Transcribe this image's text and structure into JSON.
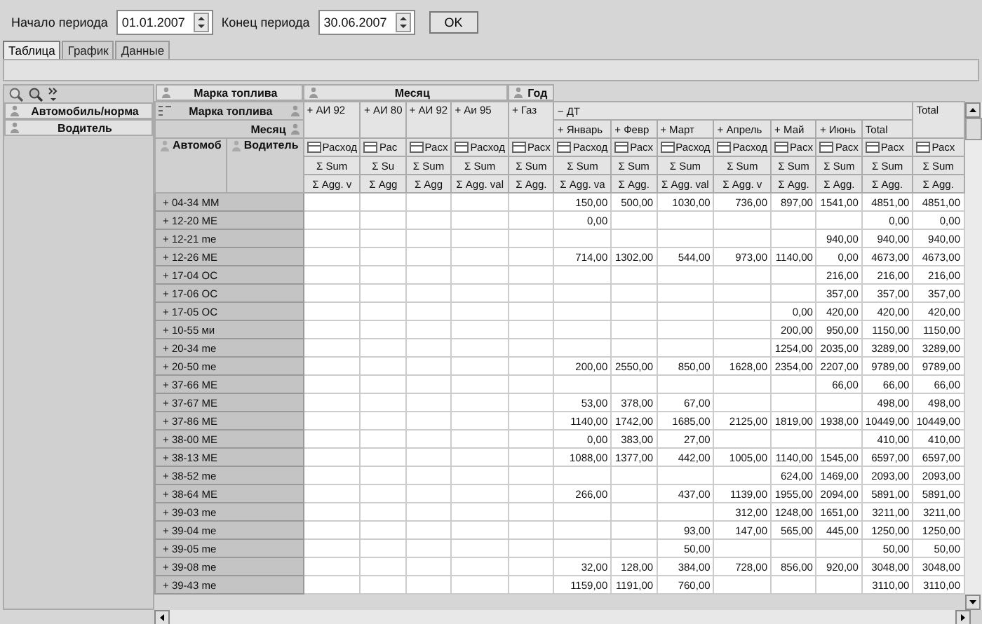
{
  "toolbar": {
    "start_label": "Начало периода",
    "start_value": "01.01.2007",
    "end_label": "Конец периода",
    "end_value": "30.06.2007",
    "ok_button": "OK"
  },
  "tabs": [
    {
      "label": "Таблица",
      "selected": true
    },
    {
      "label": "График",
      "selected": false
    },
    {
      "label": "Данные",
      "selected": false
    }
  ],
  "pivot": {
    "row_fields": [
      "Автомобиль/норма",
      "Водитель"
    ],
    "column_fields": [
      "Марка топлива",
      "Месяц",
      "Год"
    ],
    "column_area_labels": [
      "Марка топлива",
      "Месяц"
    ],
    "row_headers": [
      "Автомоб",
      "Водитель"
    ],
    "fuel_headers": [
      {
        "label": "+ АИ 92"
      },
      {
        "label": "+ АИ 80"
      },
      {
        "label": "+ АИ 92"
      },
      {
        "label": "+ Аи 95"
      },
      {
        "label": "+ Газ"
      },
      {
        "label": "− ДТ",
        "children": [
          "+ Январь",
          "+ Февр",
          "+ Март",
          "+ Апрель",
          "+ Май",
          "+ Июнь",
          "Total"
        ]
      },
      {
        "label": "Total"
      }
    ],
    "data_fields": [
      "Расход",
      "Рас",
      "Расх",
      "Расход",
      "Расх",
      "Расход",
      "Расх",
      "Расход",
      "Расход",
      "Расх",
      "Расх",
      "Расх",
      "Расх"
    ],
    "sum_row": [
      "Σ Sum",
      "Σ Su",
      "Σ Sum",
      "Σ Sum",
      "Σ Sum",
      "Σ Sum",
      "Σ Sum",
      "Σ Sum",
      "Σ Sum",
      "Σ Sum",
      "Σ Sum",
      "Σ Sum",
      "Σ Sum"
    ],
    "agg_row": [
      "Σ Agg. v",
      "Σ Agg",
      "Σ Agg",
      "Σ Agg. val",
      "Σ Agg.",
      "Σ Agg. va",
      "Σ Agg.",
      "Σ Agg. val",
      "Σ Agg. v",
      "Σ Agg.",
      "Σ Agg.",
      "Σ Agg.",
      "Σ Agg."
    ],
    "rows": [
      {
        "label": "+ 04-34 MM",
        "cells": [
          null,
          null,
          null,
          null,
          null,
          "150,00",
          "500,00",
          "1030,00",
          "736,00",
          "897,00",
          "1541,00",
          "4851,00",
          "4851,00"
        ]
      },
      {
        "label": "+ 12-20 ME",
        "cells": [
          null,
          null,
          null,
          null,
          null,
          "0,00",
          null,
          null,
          null,
          null,
          null,
          "0,00",
          "0,00"
        ]
      },
      {
        "label": "+ 12-21 me",
        "cells": [
          null,
          null,
          null,
          null,
          null,
          null,
          null,
          null,
          null,
          null,
          "940,00",
          "940,00",
          "940,00"
        ]
      },
      {
        "label": "+ 12-26 ME",
        "cells": [
          null,
          null,
          null,
          null,
          null,
          "714,00",
          "1302,00",
          "544,00",
          "973,00",
          "1140,00",
          "0,00",
          "4673,00",
          "4673,00"
        ]
      },
      {
        "label": "+ 17-04 OC",
        "cells": [
          null,
          null,
          null,
          null,
          null,
          null,
          null,
          null,
          null,
          null,
          "216,00",
          "216,00",
          "216,00"
        ]
      },
      {
        "label": "+ 17-06 OC",
        "cells": [
          null,
          null,
          null,
          null,
          null,
          null,
          null,
          null,
          null,
          null,
          "357,00",
          "357,00",
          "357,00"
        ]
      },
      {
        "label": "+ 17-05 OC",
        "cells": [
          null,
          null,
          null,
          null,
          null,
          null,
          null,
          null,
          null,
          "0,00",
          "420,00",
          "420,00",
          "420,00"
        ]
      },
      {
        "label": "+ 10-55 ми",
        "cells": [
          null,
          null,
          null,
          null,
          null,
          null,
          null,
          null,
          null,
          "200,00",
          "950,00",
          "1150,00",
          "1150,00"
        ]
      },
      {
        "label": "+ 20-34 me",
        "cells": [
          null,
          null,
          null,
          null,
          null,
          null,
          null,
          null,
          null,
          "1254,00",
          "2035,00",
          "3289,00",
          "3289,00"
        ]
      },
      {
        "label": "+ 20-50 me",
        "cells": [
          null,
          null,
          null,
          null,
          null,
          "200,00",
          "2550,00",
          "850,00",
          "1628,00",
          "2354,00",
          "2207,00",
          "9789,00",
          "9789,00"
        ]
      },
      {
        "label": "+ 37-66 ME",
        "cells": [
          null,
          null,
          null,
          null,
          null,
          null,
          null,
          null,
          null,
          null,
          "66,00",
          "66,00",
          "66,00"
        ]
      },
      {
        "label": "+ 37-67 ME",
        "cells": [
          null,
          null,
          null,
          null,
          null,
          "53,00",
          "378,00",
          "67,00",
          null,
          null,
          null,
          "498,00",
          "498,00"
        ]
      },
      {
        "label": "+ 37-86 ME",
        "cells": [
          null,
          null,
          null,
          null,
          null,
          "1140,00",
          "1742,00",
          "1685,00",
          "2125,00",
          "1819,00",
          "1938,00",
          "10449,00",
          "10449,00"
        ]
      },
      {
        "label": "+ 38-00 ME",
        "cells": [
          null,
          null,
          null,
          null,
          null,
          "0,00",
          "383,00",
          "27,00",
          null,
          null,
          null,
          "410,00",
          "410,00"
        ]
      },
      {
        "label": "+ 38-13 ME",
        "cells": [
          null,
          null,
          null,
          null,
          null,
          "1088,00",
          "1377,00",
          "442,00",
          "1005,00",
          "1140,00",
          "1545,00",
          "6597,00",
          "6597,00"
        ]
      },
      {
        "label": "+ 38-52 me",
        "cells": [
          null,
          null,
          null,
          null,
          null,
          null,
          null,
          null,
          null,
          "624,00",
          "1469,00",
          "2093,00",
          "2093,00"
        ]
      },
      {
        "label": "+ 38-64 ME",
        "cells": [
          null,
          null,
          null,
          null,
          null,
          "266,00",
          null,
          "437,00",
          "1139,00",
          "1955,00",
          "2094,00",
          "5891,00",
          "5891,00"
        ]
      },
      {
        "label": "+ 39-03 me",
        "cells": [
          null,
          null,
          null,
          null,
          null,
          null,
          null,
          null,
          "312,00",
          "1248,00",
          "1651,00",
          "3211,00",
          "3211,00"
        ]
      },
      {
        "label": "+ 39-04 me",
        "cells": [
          null,
          null,
          null,
          null,
          null,
          null,
          null,
          "93,00",
          "147,00",
          "565,00",
          "445,00",
          "1250,00",
          "1250,00"
        ]
      },
      {
        "label": "+ 39-05 me",
        "cells": [
          null,
          null,
          null,
          null,
          null,
          null,
          null,
          "50,00",
          null,
          null,
          null,
          "50,00",
          "50,00"
        ]
      },
      {
        "label": "+ 39-08 me",
        "cells": [
          null,
          null,
          null,
          null,
          null,
          "32,00",
          "128,00",
          "384,00",
          "728,00",
          "856,00",
          "920,00",
          "3048,00",
          "3048,00"
        ]
      },
      {
        "label": "+ 39-43 me",
        "cells": [
          null,
          null,
          null,
          null,
          null,
          "1159,00",
          "1191,00",
          "760,00",
          null,
          null,
          null,
          "3110,00",
          "3110,00"
        ]
      }
    ]
  }
}
